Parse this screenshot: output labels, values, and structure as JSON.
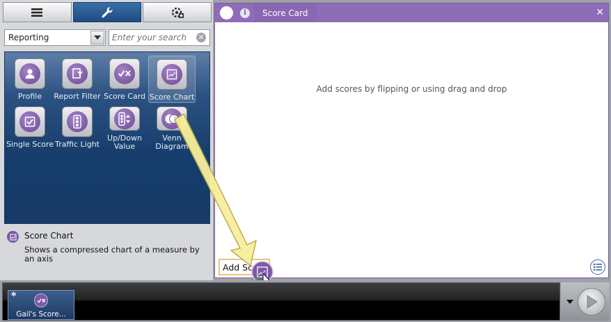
{
  "top_tabs": [
    {
      "name": "list-icon",
      "active": false
    },
    {
      "name": "wrench-icon",
      "active": true
    },
    {
      "name": "add-settings-icon",
      "active": false
    }
  ],
  "category_dropdown": {
    "value": "Reporting"
  },
  "search": {
    "placeholder": "Enter your search"
  },
  "tools": [
    {
      "label": "Profile",
      "icon": "profile-icon"
    },
    {
      "label": "Report Filter",
      "icon": "report-filter-icon"
    },
    {
      "label": "Score Card",
      "icon": "score-card-icon"
    },
    {
      "label": "Score Chart",
      "icon": "score-chart-icon",
      "selected": true
    },
    {
      "label": "Single Score",
      "icon": "single-score-icon"
    },
    {
      "label": "Traffic Light",
      "icon": "traffic-light-icon"
    },
    {
      "label": "Up/Down Value",
      "icon": "up-down-value-icon"
    },
    {
      "label": "Venn Diagram",
      "icon": "venn-diagram-icon"
    }
  ],
  "info": {
    "title": "Score Chart",
    "description": "Shows a compressed chart of a measure by an axis"
  },
  "card": {
    "title": "Score Card",
    "close": "✕",
    "empty_message": "Add scores by flipping or using drag and drop",
    "add_score_label": "Add Score"
  },
  "bottom": {
    "thumb_marker": "*",
    "thumb_label": "Gail's Score..."
  },
  "colors": {
    "accent_purple": "#8f6cb7",
    "panel_blue": "#1f4c82",
    "drag_arrow": "#f6ef9a"
  }
}
